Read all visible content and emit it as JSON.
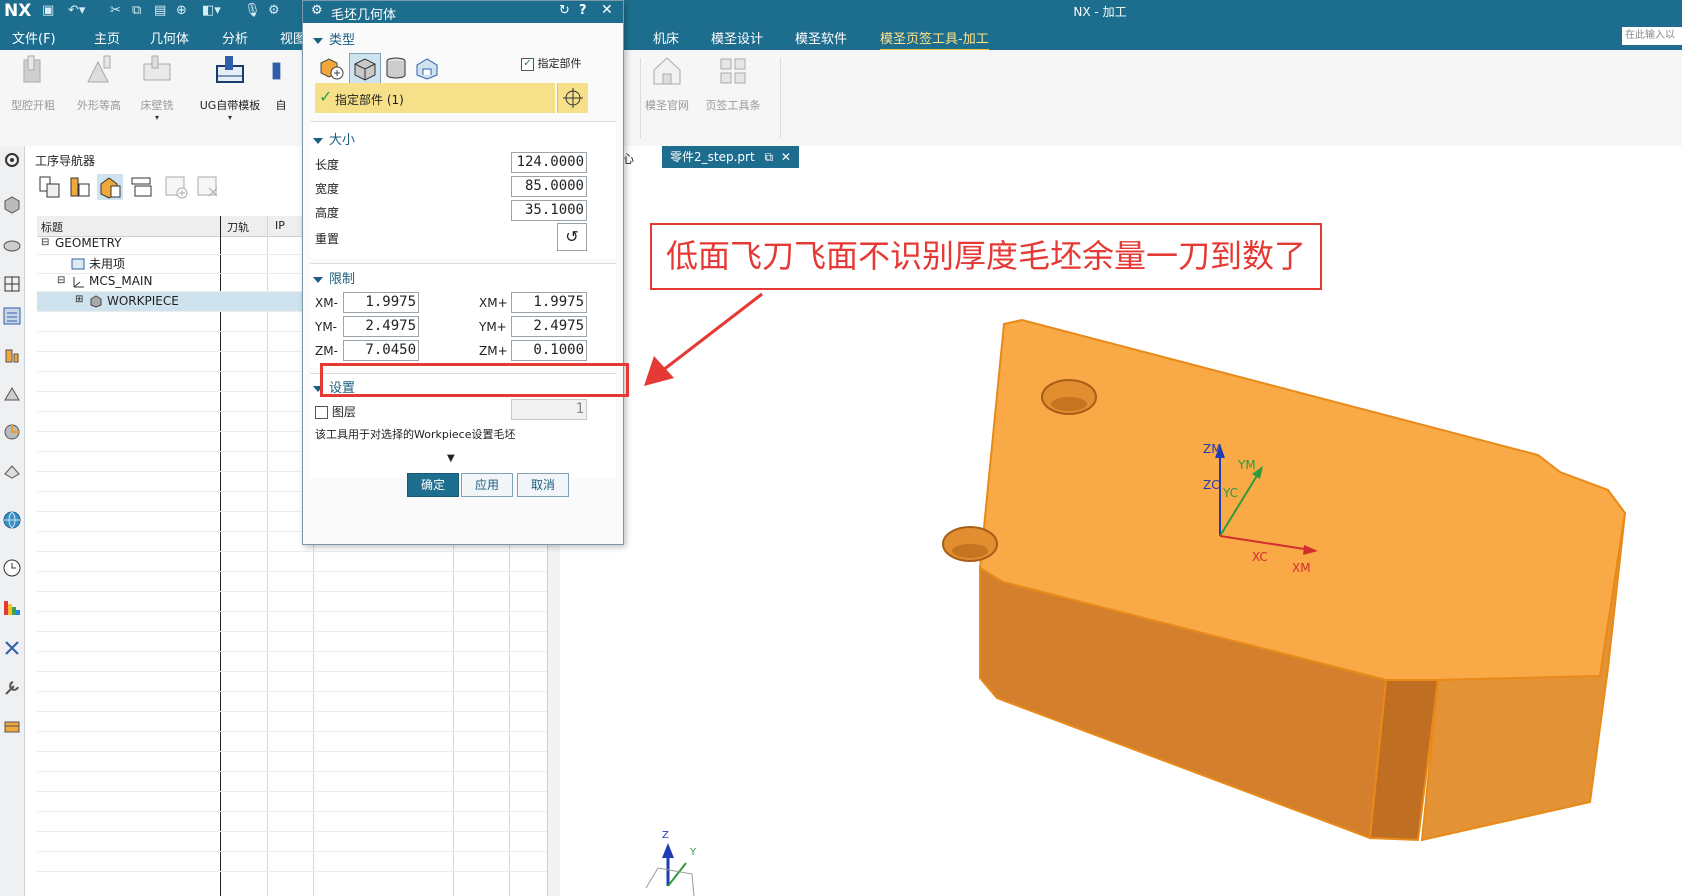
{
  "app": {
    "logo": "NX",
    "window_title": "NX - 加工",
    "search_placeholder": "在此输入以"
  },
  "menu": {
    "items": [
      "文件(F)",
      "主页",
      "几何体",
      "分析",
      "视图",
      "机床",
      "模圣设计",
      "模圣软件",
      "模圣页签工具-加工"
    ]
  },
  "ribbon": {
    "buttons": [
      "型腔开粗",
      "外形等高",
      "床壁铣",
      "UG自带模板",
      "自",
      "模圣官网",
      "页签工具条"
    ]
  },
  "navigator": {
    "title": "工序导航器",
    "columns": [
      "标题",
      "刀轨",
      "IP"
    ],
    "tree": [
      "GEOMETRY",
      "未用项",
      "MCS_MAIN",
      "WORKPIECE"
    ]
  },
  "viewport": {
    "tab_partial": "心",
    "tab_file": "零件2_step.prt",
    "annotation": "低面飞刀飞面不识别厚度毛坯余量一刀到数了",
    "axes": {
      "zm": "ZM",
      "ym": "YM",
      "zc": "ZC",
      "yc": "YC",
      "xc": "XC",
      "xm": "XM",
      "z": "Z",
      "y": "Y"
    }
  },
  "dialog": {
    "title": "毛坯几何体",
    "type_section": "类型",
    "specify_part_checkbox": "指定部件",
    "specify_part_checked": true,
    "specify_part_bar": "指定部件 (1)",
    "size_section": "大小",
    "length_label": "长度",
    "length_value": "124.0000",
    "width_label": "宽度",
    "width_value": "85.0000",
    "height_label": "高度",
    "height_value": "35.1000",
    "reset_label": "重置",
    "limit_section": "限制",
    "xm_minus_label": "XM-",
    "xm_minus_value": "1.9975",
    "xm_plus_label": "XM+",
    "xm_plus_value": "1.9975",
    "ym_minus_label": "YM-",
    "ym_minus_value": "2.4975",
    "ym_plus_label": "YM+",
    "ym_plus_value": "2.4975",
    "zm_minus_label": "ZM-",
    "zm_minus_value": "7.0450",
    "zm_plus_label": "ZM+",
    "zm_plus_value": "0.1000",
    "settings_section": "设置",
    "layer_label": "图层",
    "layer_value": "1",
    "hint": "该工具用于对选择的Workpiece设置毛坯",
    "ok": "确定",
    "apply": "应用",
    "cancel": "取消"
  },
  "colors": {
    "titlebar": "#1d6e8e",
    "part_top": "#f9a945",
    "part_front": "#d47f2e",
    "annotation": "#e53935",
    "specify_bar": "#f6e08a"
  }
}
